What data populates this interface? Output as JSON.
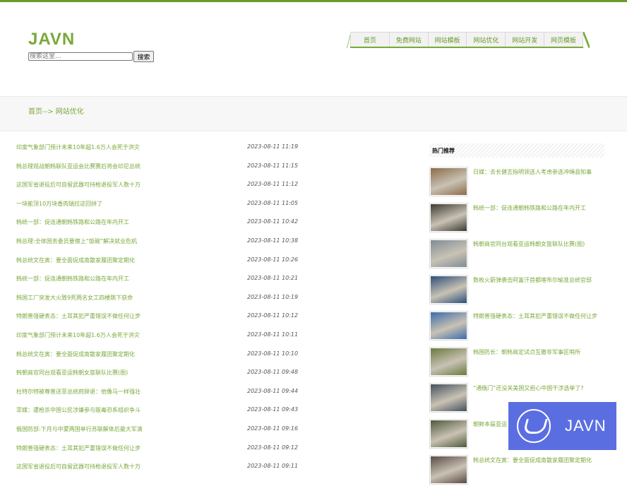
{
  "site": {
    "logo": "JAVN"
  },
  "search": {
    "placeholder": "搜索这里...",
    "button": "搜索"
  },
  "nav": {
    "tabs": [
      "首页",
      "免费网站",
      "网站模板",
      "网站优化",
      "网站开发",
      "网页模板"
    ]
  },
  "breadcrumb": "首页--> 网站优化",
  "articles": [
    {
      "title": "印度气象部门预计未来10年超1.6万人会死于洪灾",
      "date": "2023-08-11 11:19"
    },
    {
      "title": "韩总理观战朝韩联队亚运会比赛赛后将会印尼总统",
      "date": "2023-08-11 11:15"
    },
    {
      "title": "这国军省退役后可自留武器可持枪退役军人数十万",
      "date": "2023-08-11 11:12"
    },
    {
      "title": "一块能顶10万块香肉瑞拉这回拼了",
      "date": "2023-08-11 11:05"
    },
    {
      "title": "韩统一部：促连通朝韩铁路和公路在年内开工",
      "date": "2023-08-11 10:42"
    },
    {
      "title": "韩总理:全体国务委员要擦上“饭碗”解决就业危机",
      "date": "2023-08-11 10:38"
    },
    {
      "title": "韩总统文在寅：要全面促成南散家履团聚定期化",
      "date": "2023-08-11 10:26"
    },
    {
      "title": "韩统一部：促连通朝韩铁路和公路在年内开工",
      "date": "2023-08-11 10:21"
    },
    {
      "title": "韩国工厂突发大火致9死两名女工四楼跳下获命",
      "date": "2023-08-11 10:19"
    },
    {
      "title": "特朗普强硬表态：土耳其犯严重错误不做任何让步",
      "date": "2023-08-11 10:12"
    },
    {
      "title": "印度气象部门预计未来10年超1.6万人会死于洪灾",
      "date": "2023-08-11 10:11"
    },
    {
      "title": "韩总统文在寅：要全面促成南散家履团聚定期化",
      "date": "2023-08-11 10:10"
    },
    {
      "title": "韩朝商官同台观看亚运韩朝女篮联队比赛(图)",
      "date": "2023-08-11 09:48"
    },
    {
      "title": "杜特尔特被尊普送菲总统府辞退：他像马一样强壮",
      "date": "2023-08-11 09:44"
    },
    {
      "title": "菲媒：遭枪杀中国公民涉嫌参与贩毒恐系组织争斗",
      "date": "2023-08-11 09:43"
    },
    {
      "title": "俄国防部:下月与中蒙两国举行苏联解体后最大军演",
      "date": "2023-08-11 09:16"
    },
    {
      "title": "特朗普强硬表态：土耳其犯严重错误不做任何让步",
      "date": "2023-08-11 09:12"
    },
    {
      "title": "这国军省退役后可自留武器可持枪退役军人数十万",
      "date": "2023-08-11 09:11"
    }
  ],
  "sidebar": {
    "heading": "热门推荐",
    "items": [
      {
        "title": "日媒：去长健志指明领选人考虑参选冲绳县知事",
        "thumb_color": "#8b6b4a"
      },
      {
        "title": "韩统一部：促连通朝韩铁路和公路在年内开工",
        "thumb_color": "#3d3a33"
      },
      {
        "title": "韩朝商官同台观看亚运韩朝女篮联队比赛(图)",
        "thumb_color": "#7f8c96"
      },
      {
        "title": "数枚火箭弹袭击阿富汗首都喀布尔瑜准总统官邸",
        "thumb_color": "#2d4f7a"
      },
      {
        "title": "特朗普强硬表态：土耳其犯严重错误不做任何让步",
        "thumb_color": "#3b6ca8"
      },
      {
        "title": "韩国防长：朝韩商定试点互撤非军事区哨所",
        "thumb_color": "#6b7a3e"
      },
      {
        "title": "“通俄门”还没关美国又担心中国干涉选举了?",
        "thumb_color": "#44515d"
      },
      {
        "title": "朝鲜本届亚运",
        "thumb_color": "#4e5a3a"
      },
      {
        "title": "韩总统文在寅：要全面促成南散家履团聚定期化",
        "thumb_color": "#5a4a44"
      }
    ]
  },
  "badge": {
    "text": "JAVN"
  },
  "theme": {
    "accent": "#7aa83a",
    "badge_bg": "#5b6ee1"
  }
}
